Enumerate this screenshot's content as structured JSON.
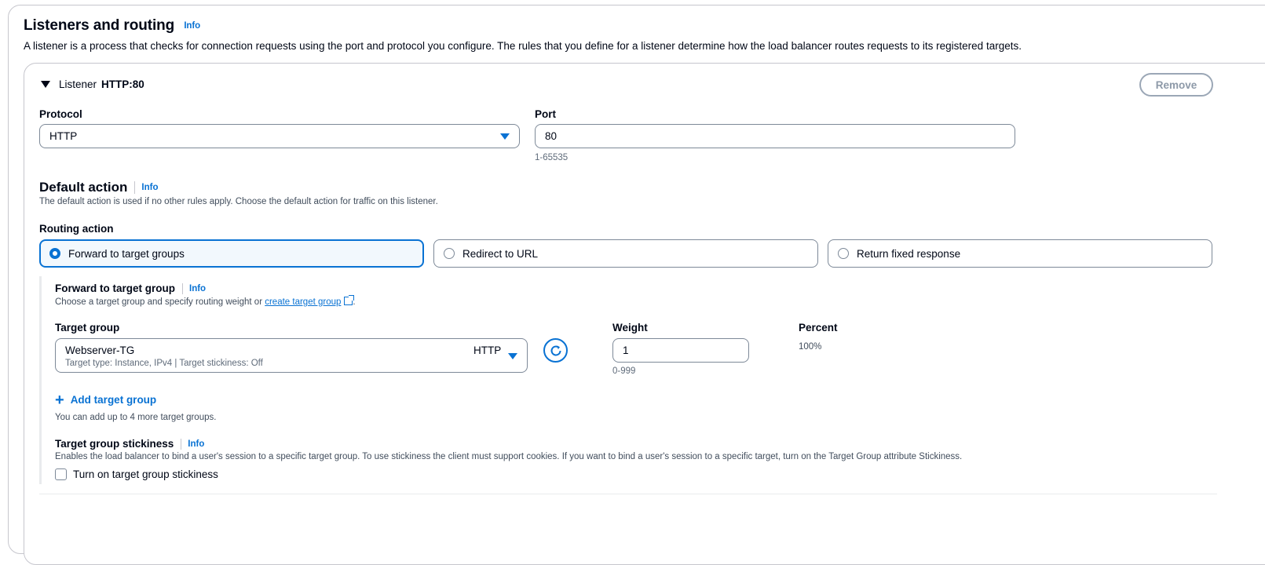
{
  "section": {
    "title": "Listeners and routing",
    "info": "Info",
    "description": "A listener is a process that checks for connection requests using the port and protocol you configure. The rules that you define for a listener determine how the load balancer routes requests to its registered targets."
  },
  "listener": {
    "label": "Listener",
    "value": "HTTP:80",
    "remove_label": "Remove",
    "protocol_label": "Protocol",
    "protocol_value": "HTTP",
    "port_label": "Port",
    "port_value": "80",
    "port_hint": "1-65535"
  },
  "default_action": {
    "title": "Default action",
    "info": "Info",
    "description": "The default action is used if no other rules apply. Choose the default action for traffic on this listener.",
    "routing_label": "Routing action",
    "options": [
      {
        "label": "Forward to target groups",
        "selected": true
      },
      {
        "label": "Redirect to URL",
        "selected": false
      },
      {
        "label": "Return fixed response",
        "selected": false
      }
    ]
  },
  "forward": {
    "title": "Forward to target group",
    "info": "Info",
    "desc_prefix": "Choose a target group and specify routing weight or ",
    "desc_link": "create target group",
    "desc_suffix": ".",
    "target_group_label": "Target group",
    "target_group_name": "Webserver-TG",
    "target_group_meta": "Target type: Instance, IPv4 | Target stickiness: Off",
    "target_group_protocol": "HTTP",
    "weight_label": "Weight",
    "weight_value": "1",
    "weight_hint": "0-999",
    "percent_label": "Percent",
    "percent_value": "100%",
    "add_label": "Add target group",
    "add_hint": "You can add up to 4 more target groups."
  },
  "stickiness": {
    "title": "Target group stickiness",
    "info": "Info",
    "description": "Enables the load balancer to bind a user's session to a specific target group. To use stickiness the client must support cookies. If you want to bind a user's session to a specific target, turn on the Target Group attribute Stickiness.",
    "checkbox_label": "Turn on target group stickiness",
    "checked": false
  },
  "colors": {
    "accent": "#0972d3",
    "border": "#7d8998",
    "text": "#000716"
  }
}
